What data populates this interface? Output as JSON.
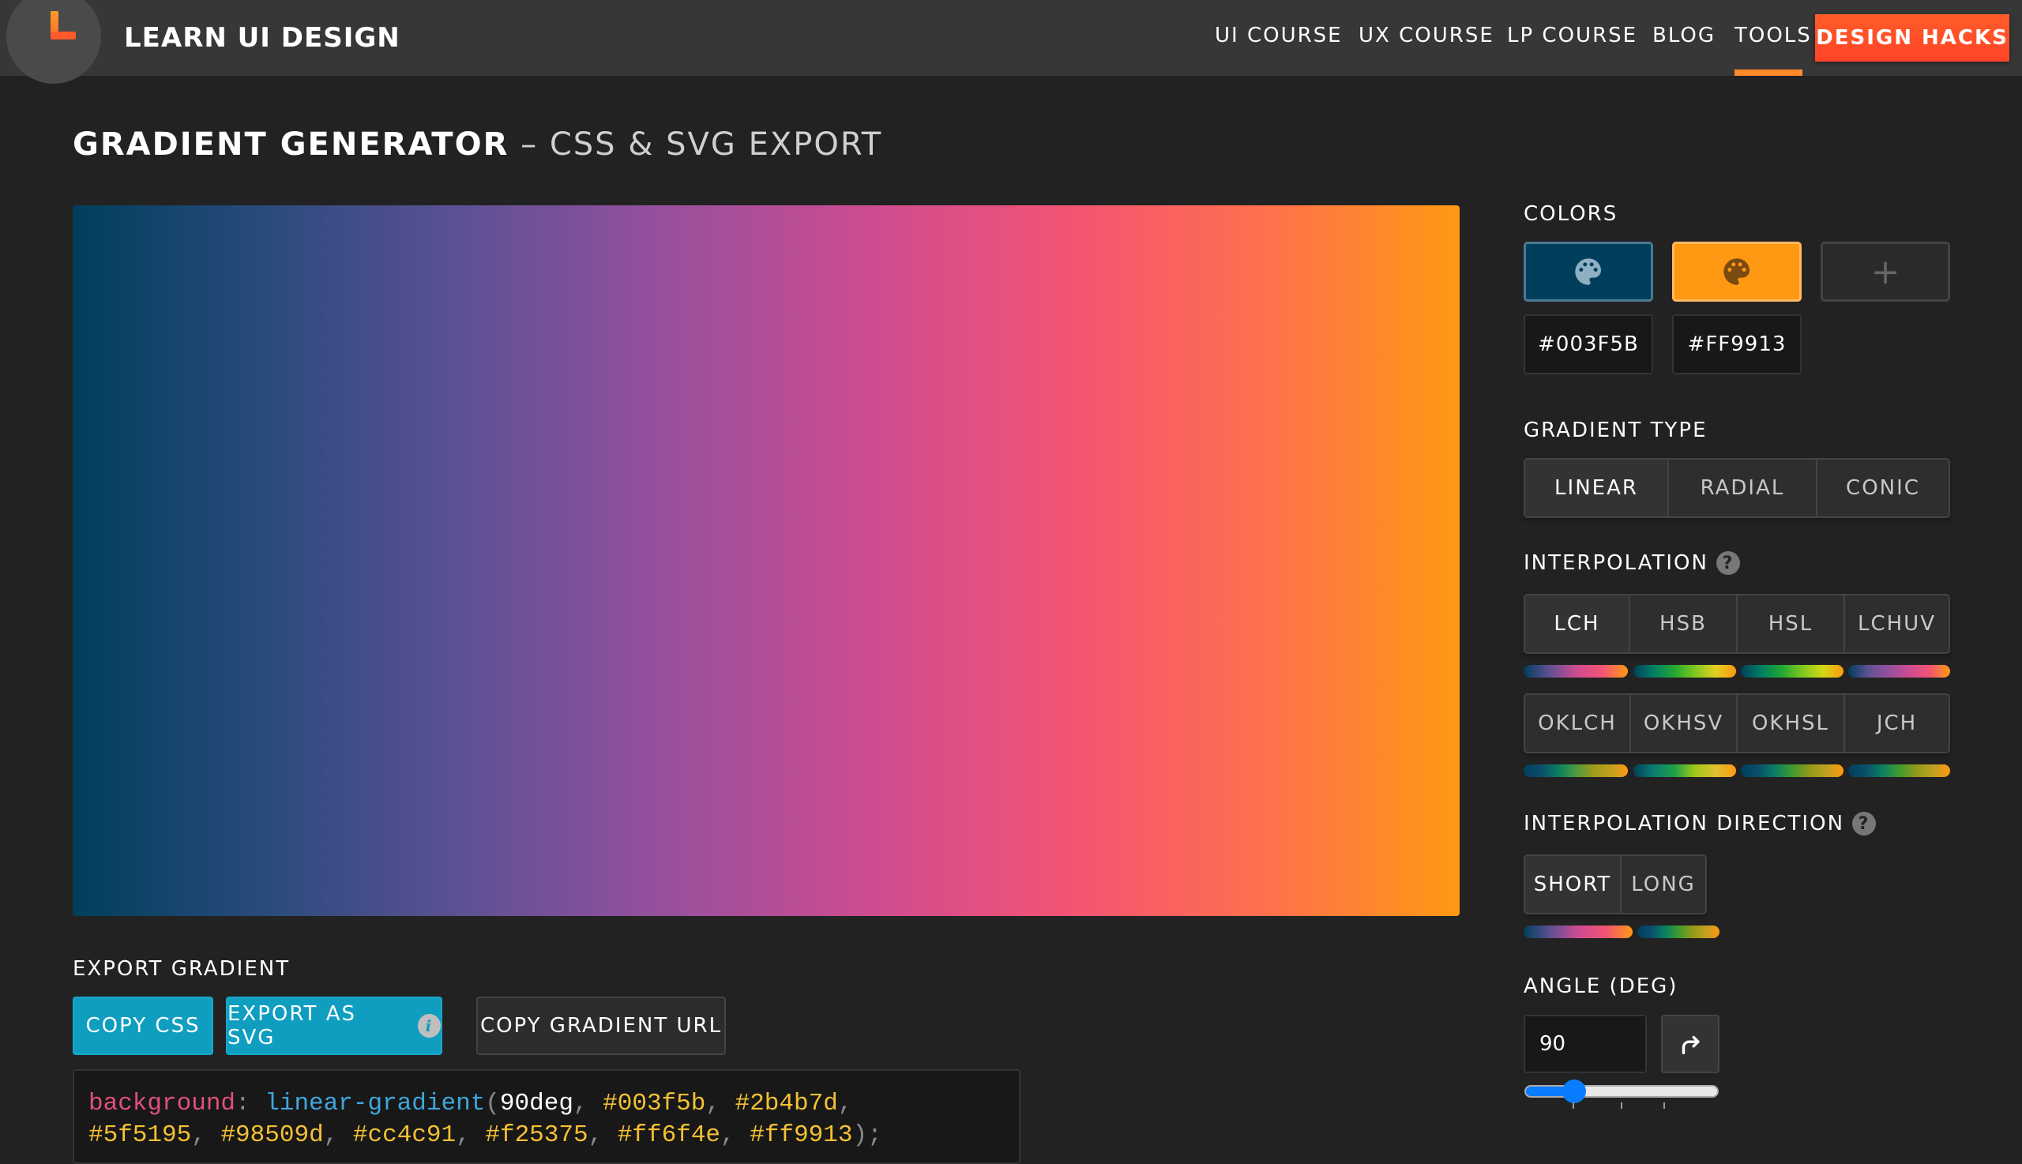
{
  "header": {
    "brand": "LEARN UI DESIGN",
    "logo_icon": "logo-l-icon",
    "nav": [
      {
        "label": "UI COURSE",
        "active": false
      },
      {
        "label": "UX COURSE",
        "active": false
      },
      {
        "label": "LP COURSE",
        "active": false
      },
      {
        "label": "BLOG",
        "active": false
      },
      {
        "label": "TOOLS",
        "active": true
      }
    ],
    "cta_label": "DESIGN HACKS",
    "accent": "#FF4B26"
  },
  "page": {
    "title": "GRADIENT GENERATOR",
    "subtitle": " – CSS & SVG EXPORT"
  },
  "preview": {
    "angle_deg": 90,
    "stops": [
      "#003f5b",
      "#2b4b7d",
      "#5f5195",
      "#98509d",
      "#cc4c91",
      "#f25375",
      "#ff6f4e",
      "#ff9913"
    ]
  },
  "export": {
    "label": "EXPORT GRADIENT",
    "copy_css": "COPY CSS",
    "export_svg": "EXPORT AS SVG",
    "info_icon": "info-icon",
    "copy_url": "COPY GRADIENT URL",
    "code": {
      "property": "background",
      "function": "linear-gradient",
      "angle": "90deg",
      "line1_hexes": [
        "#003f5b",
        "#2b4b7d"
      ],
      "line2_hexes": [
        "#5f5195",
        "#98509d",
        "#cc4c91",
        "#f25375",
        "#ff6f4e",
        "#ff9913"
      ]
    }
  },
  "colors": {
    "label": "COLORS",
    "swatches": [
      {
        "hex": "#003F5B",
        "icon": "palette-icon"
      },
      {
        "hex": "#FF9913",
        "icon": "palette-icon"
      }
    ],
    "add_label": "+"
  },
  "gradient_type": {
    "label": "GRADIENT TYPE",
    "options": [
      "LINEAR",
      "RADIAL",
      "CONIC"
    ],
    "selected": "LINEAR"
  },
  "interpolation": {
    "label": "INTERPOLATION",
    "row1": [
      "LCH",
      "HSB",
      "HSL",
      "LCHUV"
    ],
    "row2": [
      "OKLCH",
      "OKHSV",
      "OKHSL",
      "JCH"
    ],
    "selected": "LCH",
    "previews": {
      "LCH": [
        "#003f5b",
        "#5f5195",
        "#cc4c91",
        "#f25375",
        "#ff9913"
      ],
      "HSB": [
        "#003f5b",
        "#007f63",
        "#22a832",
        "#80c820",
        "#e0d020",
        "#ff9913"
      ],
      "HSL": [
        "#003f5b",
        "#007f63",
        "#22a832",
        "#80c820",
        "#d4d815",
        "#ff9913"
      ],
      "LCHUV": [
        "#003f5b",
        "#5f5195",
        "#98509d",
        "#cc4c91",
        "#f25375",
        "#ff9913"
      ],
      "OKLCH": [
        "#003f5b",
        "#0a4d6b",
        "#0a7f63",
        "#4a9a40",
        "#a09a1a",
        "#c0a020",
        "#ff9913"
      ],
      "OKHSV": [
        "#003f5b",
        "#0a7f70",
        "#1fa04a",
        "#a0c818",
        "#e0c030",
        "#ff9913"
      ],
      "OKHSL": [
        "#003f5b",
        "#0a4d6b",
        "#0a7f63",
        "#3f9a30",
        "#909a1a",
        "#c0a020",
        "#ff9913"
      ],
      "JCH": [
        "#003f5b",
        "#0a4d6b",
        "#0a7f63",
        "#3f9a30",
        "#909a1a",
        "#c0a020",
        "#ff9913"
      ]
    }
  },
  "direction": {
    "label": "INTERPOLATION DIRECTION",
    "options": [
      "SHORT",
      "LONG"
    ],
    "selected": "SHORT",
    "previews": {
      "SHORT": [
        "#003f5b",
        "#5f5195",
        "#cc4c91",
        "#f25375",
        "#ff9913"
      ],
      "LONG": [
        "#003f5b",
        "#0a4d6b",
        "#0a7f63",
        "#3f9a30",
        "#909a1a",
        "#c0a020",
        "#ff9913"
      ]
    }
  },
  "angle": {
    "label": "ANGLE (DEG)",
    "value": "90",
    "rotate_icon": "rotate-right-icon",
    "slider_fraction": 0.25
  }
}
